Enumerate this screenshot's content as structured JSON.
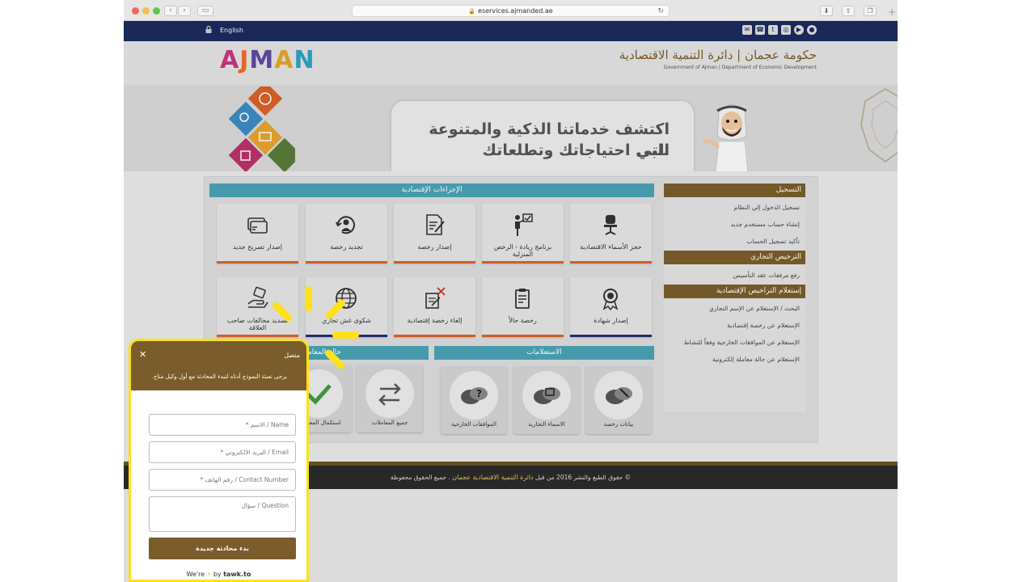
{
  "browser": {
    "url": "eservices.ajmanded.ae"
  },
  "topbar": {
    "language_link": "English",
    "icons": [
      "mail-icon",
      "phone-icon",
      "twitter-icon",
      "instagram-icon",
      "youtube-icon",
      "app-icon"
    ]
  },
  "header": {
    "logo_letters": [
      "A",
      "J",
      "M",
      "A",
      "N"
    ],
    "logo_colors": [
      "#c7367e",
      "#ef6c2c",
      "#5b4aa0",
      "#e4a52e",
      "#29a3c4"
    ],
    "gov_name_ar": "حكومة عجمان | دائرة التنمية الاقتصادية",
    "gov_name_en": "Government of Ajman | Department of Economic Development"
  },
  "banner": {
    "line1": "اكتشف خدماتنا الذكية والمتنوعة التي",
    "line2": "تلبي احتياجاتك وتطلعاتك"
  },
  "economic_procedures": {
    "title": "الإجراءات الإقتصادية",
    "row1": [
      {
        "label": "حجز الأسماء الاقتصادية",
        "icon": "office-chair-icon",
        "stripe": "#d8622a"
      },
      {
        "label": "برنامج ريادة - الرخص المنزلية",
        "icon": "presenter-icon",
        "stripe": "#d8622a"
      },
      {
        "label": "إصدار رخصة",
        "icon": "document-sign-icon",
        "stripe": "#d8622a"
      },
      {
        "label": "تجديد رخصة",
        "icon": "renew-person-icon",
        "stripe": "#d8622a"
      },
      {
        "label": "إصدار تصريح جديد",
        "icon": "card-icon",
        "stripe": "#d8622a"
      }
    ],
    "row2": [
      {
        "label": "إصدار شهادة",
        "icon": "award-icon",
        "stripe": "#22306b"
      },
      {
        "label": "رخصة حالاً",
        "icon": "clipboard-icon",
        "stripe": "#d8622a"
      },
      {
        "label": "إلغاء رخصة إقتصادية",
        "icon": "cancel-document-icon",
        "stripe": "#d8622a"
      },
      {
        "label": "شكوى غش تجاري",
        "icon": "globe-icon",
        "stripe": "#22306b"
      },
      {
        "label": "تسديد مخالفات صاحب العلاقة",
        "icon": "pay-hand-icon",
        "stripe": "#d8622a"
      }
    ]
  },
  "transactions": {
    "title": "حالة المعاملات",
    "cards": [
      {
        "label": "جميع المعاملات",
        "icon": "exchange-arrows-icon"
      },
      {
        "label": "استكمال المعاملات",
        "icon": "checkmark-icon"
      }
    ]
  },
  "inquiries": {
    "title": "الاستعلامات",
    "cards": [
      {
        "label": "بيانات رخصة",
        "icon": "license-chat-icon"
      },
      {
        "label": "الاسماء التجارية",
        "icon": "trade-names-chat-icon"
      },
      {
        "label": "الموافقات الخارجية",
        "icon": "question-chat-icon"
      }
    ]
  },
  "sidebar": {
    "sections": [
      {
        "title": "التسجيل",
        "items": [
          "تسجيل الدخول إلي النظام",
          "إنشاء حساب مستخدم جديد",
          "تأكيد تسجيل الحساب"
        ]
      },
      {
        "title": "الترخيص التجاري",
        "items": [
          "رفع مرفقات عقد التأسيس"
        ]
      },
      {
        "title": "إستعلام التراخيص الإقتصادية",
        "items": [
          "البحث / الإستعلام عن الإسم التجاري",
          "الإستعلام عن رخصة إقتصادية",
          "الإستعلام عن الموافقات الخارجية وفقاً للنشاط",
          "الإستعلام عن حالة معاملة إلكترونية"
        ]
      }
    ]
  },
  "footer": {
    "pre": "© حقوق الطبع والنشر 2016 من قبل",
    "highlight": "دائرة التنمية الاقتصادية عجمان",
    "post": ". جميع الحقوق محفوظة"
  },
  "chat": {
    "status": "متصل",
    "message": "يرجى تعبئة النموذج أدناه لتبدء المحادثة مع أول وكيل متاح.",
    "name_placeholder": "* الاسم / Name",
    "email_placeholder": "* البريد الالكتروني / Email",
    "phone_placeholder": "* رقم الهاتف / Contact Number",
    "question_placeholder": "سؤال / Question",
    "submit_label": "بدء محادثة جديدة",
    "credit_pre": "We're",
    "credit_mid": "by",
    "credit_brand": "tawk.to"
  }
}
